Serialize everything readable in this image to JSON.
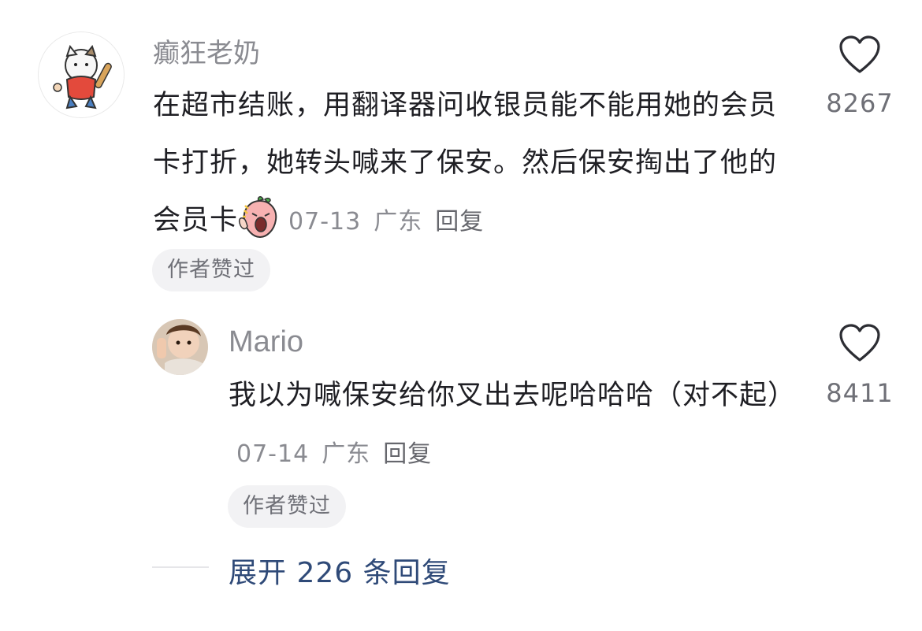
{
  "comment": {
    "author": "癫狂老奶",
    "text": "在超市结账，用翻译器问收银员能不能用她的会员卡打折，她转头喊来了保安。然后保安掏出了他的会员卡",
    "date": "07-13",
    "location": "广东",
    "reply_label": "回复",
    "likes": "8267",
    "badge": "作者赞过",
    "emoji": "screaming-peach-emoji"
  },
  "reply": {
    "author": "Mario",
    "text": "我以为喊保安给你叉出去呢哈哈哈（对不起）",
    "date": "07-14",
    "location": "广东",
    "reply_label": "回复",
    "likes": "8411",
    "badge": "作者赞过"
  },
  "expand_label": "展开 226 条回复",
  "icons": {
    "like": "heart-outline-icon"
  },
  "colors": {
    "expand_text": "#2f4a78",
    "meta_gray": "#8a8b91"
  }
}
